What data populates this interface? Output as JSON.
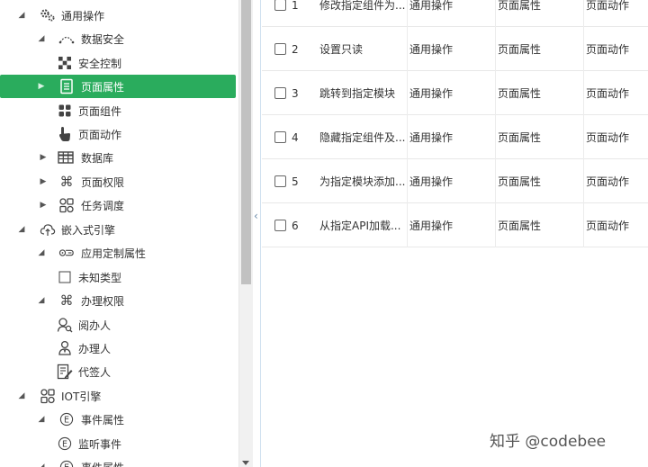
{
  "tree": {
    "nodes": [
      {
        "label": "通用操作",
        "icon": "gears-icon",
        "arrow": "expanded"
      },
      {
        "label": "数据安全",
        "icon": "arc-icon",
        "arrow": "expanded"
      },
      {
        "label": "安全控制",
        "icon": "checker-icon",
        "arrow": "none"
      },
      {
        "label": "页面属性",
        "icon": "page-icon",
        "arrow": "collapsed",
        "selected": true
      },
      {
        "label": "页面组件",
        "icon": "grid-icon",
        "arrow": "none"
      },
      {
        "label": "页面动作",
        "icon": "hand-pointer-icon",
        "arrow": "none"
      },
      {
        "label": "数据库",
        "icon": "table-icon",
        "arrow": "collapsed"
      },
      {
        "label": "页面权限",
        "icon": "command-icon",
        "arrow": "collapsed"
      },
      {
        "label": "任务调度",
        "icon": "tasks-icon",
        "arrow": "collapsed"
      },
      {
        "label": "嵌入式引擎",
        "icon": "cloud-upload-icon",
        "arrow": "expanded"
      },
      {
        "label": "应用定制属性",
        "icon": "custom-attr-icon",
        "arrow": "expanded"
      },
      {
        "label": "未知类型",
        "icon": "square-icon",
        "arrow": "none"
      },
      {
        "label": "办理权限",
        "icon": "command-icon",
        "arrow": "expanded"
      },
      {
        "label": "阅办人",
        "icon": "reader-icon",
        "arrow": "none"
      },
      {
        "label": "办理人",
        "icon": "person-icon",
        "arrow": "none"
      },
      {
        "label": "代签人",
        "icon": "sign-icon",
        "arrow": "none"
      },
      {
        "label": "IOT引擎",
        "icon": "tasks-icon",
        "arrow": "expanded"
      },
      {
        "label": "事件属性",
        "icon": "e-circle-icon",
        "arrow": "expanded"
      },
      {
        "label": "监听事件",
        "icon": "e-circle-icon",
        "arrow": "none"
      },
      {
        "label": "事件属性",
        "icon": "e-circle-icon",
        "arrow": "expanded"
      }
    ]
  },
  "grid": {
    "rows": [
      {
        "num": "1",
        "name": "修改指定组件为...",
        "c2": "通用操作",
        "c3": "页面属性",
        "c4": "页面动作"
      },
      {
        "num": "2",
        "name": "设置只读",
        "c2": "通用操作",
        "c3": "页面属性",
        "c4": "页面动作"
      },
      {
        "num": "3",
        "name": "跳转到指定模块",
        "c2": "通用操作",
        "c3": "页面属性",
        "c4": "页面动作"
      },
      {
        "num": "4",
        "name": "隐藏指定组件及...",
        "c2": "通用操作",
        "c3": "页面属性",
        "c4": "页面动作"
      },
      {
        "num": "5",
        "name": "为指定模块添加...",
        "c2": "通用操作",
        "c3": "页面属性",
        "c4": "页面动作"
      },
      {
        "num": "6",
        "name": "从指定API加载...",
        "c2": "通用操作",
        "c3": "页面属性",
        "c4": "页面动作"
      }
    ]
  },
  "watermark": "知乎 @codebee",
  "colors": {
    "selected_bg": "#2aac5d"
  }
}
